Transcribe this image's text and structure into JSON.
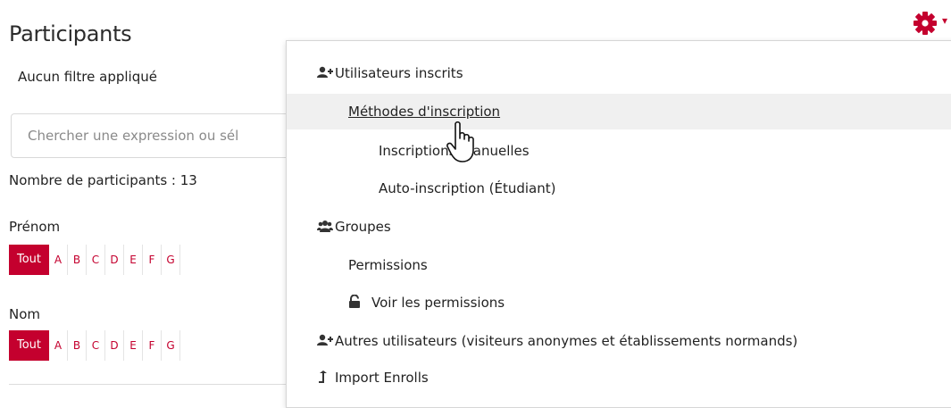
{
  "page": {
    "title": "Participants",
    "filter_status": "Aucun filtre appliqué",
    "search_placeholder": "Chercher une expression ou sél",
    "participant_count": "Nombre de participants : 13"
  },
  "first_name_filter": {
    "label": "Prénom",
    "all": "Tout",
    "letters": [
      "A",
      "B",
      "C",
      "D",
      "E",
      "F",
      "G"
    ]
  },
  "last_name_filter": {
    "label": "Nom",
    "all": "Tout",
    "letters": [
      "A",
      "B",
      "C",
      "D",
      "E",
      "F",
      "G"
    ]
  },
  "settings_menu": {
    "gear_icon": "gear-icon",
    "items": [
      {
        "label": "Utilisateurs inscrits",
        "icon": "user-plus-icon"
      },
      {
        "label": "Méthodes d'inscription"
      },
      {
        "label": "Inscriptions manuelles"
      },
      {
        "label": "Auto-inscription (Étudiant)"
      },
      {
        "label": "Groupes",
        "icon": "users-icon"
      },
      {
        "label": "Permissions"
      },
      {
        "label": "Voir les permissions",
        "icon": "unlock-icon"
      },
      {
        "label": "Autres utilisateurs (visiteurs anonymes et établissements normands)",
        "icon": "user-plus-icon"
      },
      {
        "label": "Import Enrolls",
        "icon": "upload-icon"
      }
    ]
  },
  "colors": {
    "accent": "#c4002e",
    "hover": "#f0f0f0"
  }
}
